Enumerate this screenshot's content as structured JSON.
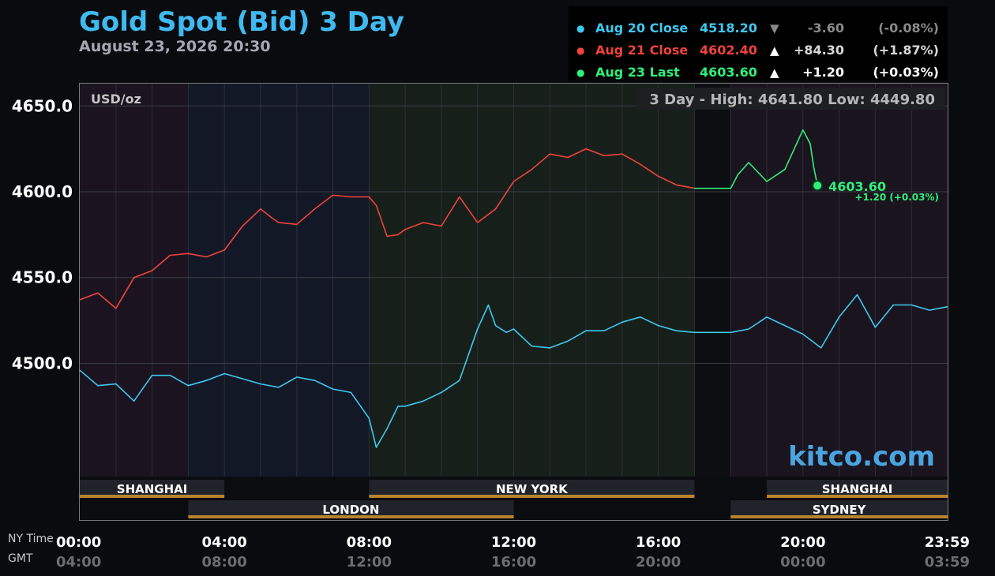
{
  "header": {
    "title": "Gold Spot (Bid) 3 Day",
    "timestamp": "August 23, 2026 20:30"
  },
  "legend": [
    {
      "label": "Aug 20 Close",
      "price": "4518.20",
      "arrow": "▼",
      "change": "-3.60",
      "pct": "(-0.08%)",
      "color": "#3fc8ef",
      "arrow_color": "#888888",
      "chg_color": "#8a8a8a"
    },
    {
      "label": "Aug 21 Close",
      "price": "4602.40",
      "arrow": "▲",
      "change": "+84.30",
      "pct": "(+1.87%)",
      "color": "#f0433c",
      "arrow_color": "#ffffff",
      "chg_color": "#d8d8d8"
    },
    {
      "label": "Aug 23 Last",
      "price": "4603.60",
      "arrow": "▲",
      "change": "+1.20",
      "pct": "(+0.03%)",
      "color": "#2ef07a",
      "arrow_color": "#ffffff",
      "chg_color": "#ffffff"
    }
  ],
  "unit_label": "USD/oz",
  "range_text": "3 Day - High: 4641.80  Low: 4449.80",
  "last_value_label": "4603.60",
  "last_change_label": "+1.20 (+0.03%)",
  "watermark": "kitco.com",
  "time_row_labels": {
    "ny": "NY Time",
    "gmt": "GMT"
  },
  "sessions": [
    {
      "name": "SHANGHAI",
      "start": 0,
      "end": 4,
      "row": 0
    },
    {
      "name": "NEW YORK",
      "start": 8,
      "end": 17,
      "row": 0
    },
    {
      "name": "SHANGHAI",
      "start": 19,
      "end": 24,
      "row": 0
    },
    {
      "name": "LONDON",
      "start": 3,
      "end": 12,
      "row": 1
    },
    {
      "name": "SYDNEY",
      "start": 18,
      "end": 24,
      "row": 1
    }
  ],
  "chart_data": {
    "type": "line",
    "title": "Gold Spot (Bid) 3 Day",
    "ylabel": "USD/oz",
    "xlim": [
      0,
      24
    ],
    "ylim": [
      4434,
      4663
    ],
    "y_ticks": [
      "4500.0",
      "4550.0",
      "4600.0",
      "4650.0"
    ],
    "x_ticks_ny": [
      "00:00",
      "04:00",
      "08:00",
      "12:00",
      "16:00",
      "20:00",
      "23:59"
    ],
    "x_ticks_gmt": [
      "04:00",
      "08:00",
      "12:00",
      "16:00",
      "20:00",
      "00:00",
      "03:59"
    ],
    "high": 4641.8,
    "low": 4449.8,
    "series": [
      {
        "name": "Aug 20 Close",
        "color": "#3fc8ef",
        "x": [
          0,
          0.5,
          1,
          1.5,
          2,
          2.5,
          3,
          3.5,
          4,
          4.5,
          5,
          5.5,
          6,
          6.5,
          7,
          7.5,
          8,
          8.2,
          8.5,
          8.8,
          9,
          9.5,
          10,
          10.5,
          11,
          11.3,
          11.5,
          11.8,
          12,
          12.5,
          13,
          13.5,
          14,
          14.5,
          15,
          15.5,
          16,
          16.5,
          17,
          17.5,
          18,
          18.5,
          19,
          19.5,
          20,
          20.5,
          21,
          21.5,
          22,
          22.5,
          23,
          23.5,
          24
        ],
        "y": [
          4496,
          4487,
          4488,
          4478,
          4493,
          4493,
          4487,
          4490,
          4494,
          4491,
          4488,
          4486,
          4492,
          4490,
          4485,
          4483,
          4468,
          4451,
          4462,
          4475,
          4475,
          4478,
          4483,
          4490,
          4520,
          4534,
          4522,
          4518,
          4520,
          4510,
          4509,
          4513,
          4519,
          4519,
          4524,
          4527,
          4522,
          4519,
          4518,
          4518,
          4518,
          4520,
          4527,
          4522,
          4517,
          4509,
          4527,
          4540,
          4521,
          4534,
          4534,
          4531,
          4533
        ]
      },
      {
        "name": "Aug 21 Close",
        "color": "#f0433c",
        "x": [
          0,
          0.5,
          1,
          1.5,
          2,
          2.5,
          3,
          3.5,
          4,
          4.5,
          5,
          5.3,
          5.5,
          6,
          6.5,
          7,
          7.5,
          8,
          8.2,
          8.5,
          8.8,
          9,
          9.5,
          10,
          10.5,
          11,
          11.5,
          12,
          12.5,
          13,
          13.5,
          14,
          14.5,
          15,
          15.5,
          16,
          16.5,
          17
        ],
        "y": [
          4537,
          4541,
          4532,
          4550,
          4554,
          4563,
          4564,
          4562,
          4566,
          4580,
          4590,
          4585,
          4582,
          4581,
          4590,
          4598,
          4597,
          4597,
          4592,
          4574,
          4575,
          4578,
          4582,
          4580,
          4597,
          4582,
          4590,
          4606,
          4613,
          4622,
          4620,
          4625,
          4621,
          4622,
          4616,
          4609,
          4604,
          4602
        ]
      },
      {
        "name": "Aug 23 Last",
        "color": "#2ef07a",
        "x": [
          17,
          18,
          18.2,
          18.5,
          19,
          19.5,
          20,
          20.2,
          20.3,
          20.4
        ],
        "y": [
          4602,
          4602,
          4610,
          4617,
          4606,
          4613,
          4636,
          4628,
          4614,
          4603.6
        ]
      }
    ]
  }
}
